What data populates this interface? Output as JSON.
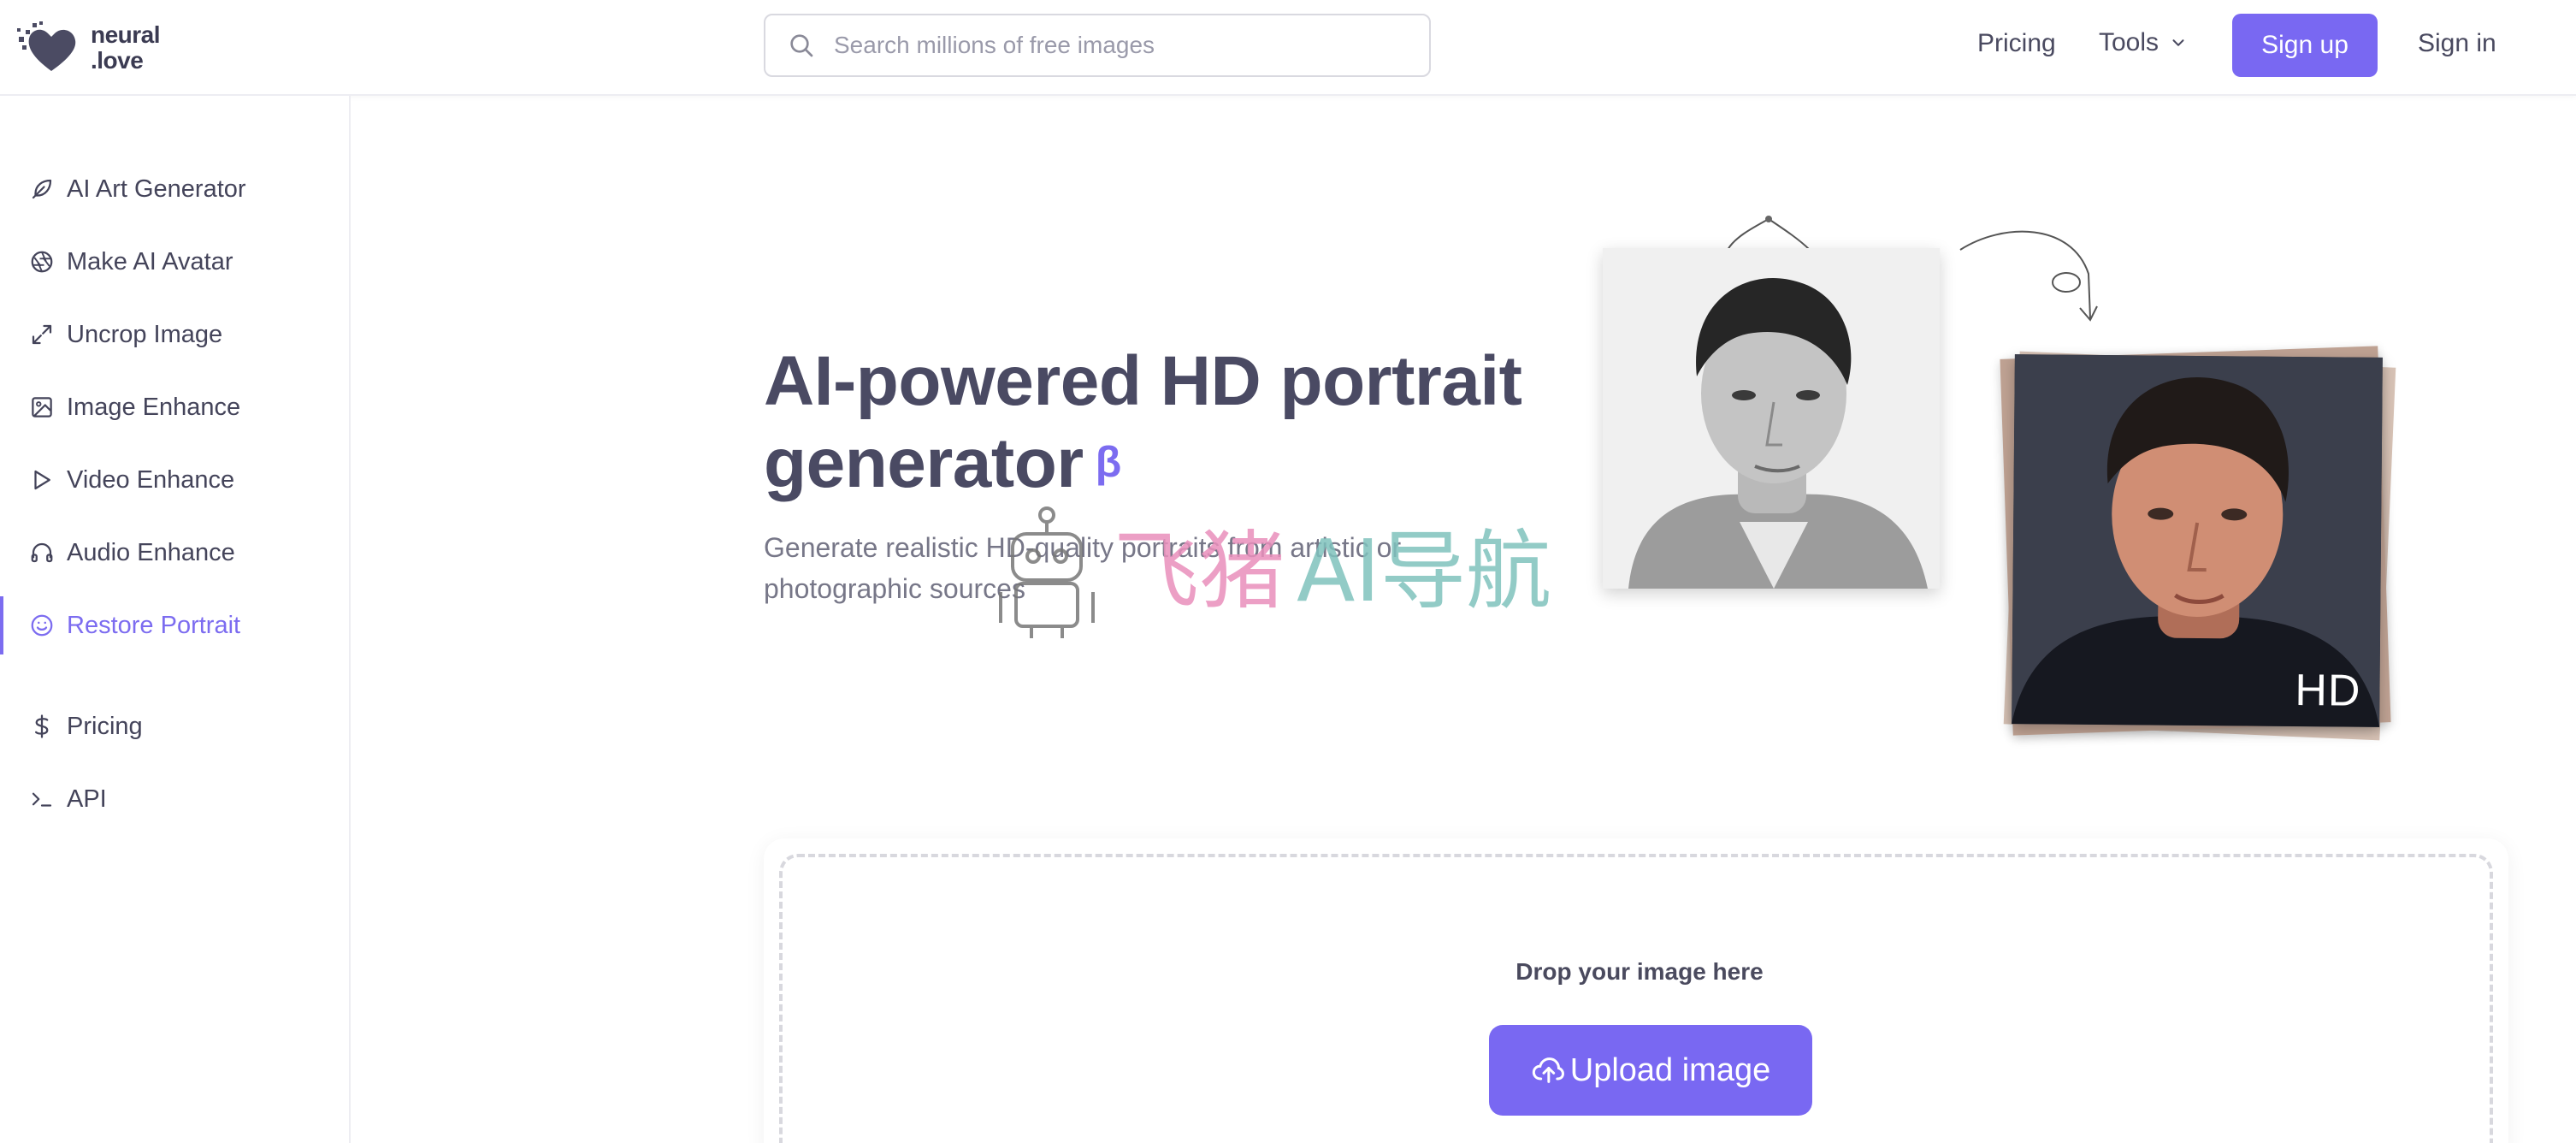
{
  "header": {
    "logo_line1": "neural",
    "logo_line2": ".love",
    "search_placeholder": "Search millions of free images",
    "nav_pricing": "Pricing",
    "nav_tools": "Tools",
    "signup_label": "Sign up",
    "signin_label": "Sign in"
  },
  "sidebar": {
    "items": [
      {
        "label": "AI Art Generator",
        "icon": "feather-icon"
      },
      {
        "label": "Make AI Avatar",
        "icon": "aperture-icon"
      },
      {
        "label": "Uncrop Image",
        "icon": "expand-icon"
      },
      {
        "label": "Image Enhance",
        "icon": "image-icon"
      },
      {
        "label": "Video Enhance",
        "icon": "play-icon"
      },
      {
        "label": "Audio Enhance",
        "icon": "headphones-icon"
      },
      {
        "label": "Restore Portrait",
        "icon": "smile-icon",
        "active": true
      },
      {
        "label": "Pricing",
        "icon": "dollar-icon"
      },
      {
        "label": "API",
        "icon": "terminal-icon"
      }
    ]
  },
  "hero": {
    "title": "AI-powered HD portrait generator",
    "beta": "β",
    "subtitle": "Generate realistic HD-quality portraits from artistic or photographic sources",
    "hd_label": "HD"
  },
  "watermark": {
    "part1": "飞猪",
    "part2": "AI导航"
  },
  "upload": {
    "drop_label": "Drop your image here",
    "button_label": "Upload image"
  },
  "colors": {
    "accent": "#7968f2",
    "text": "#4a4a63",
    "muted": "#777788"
  }
}
